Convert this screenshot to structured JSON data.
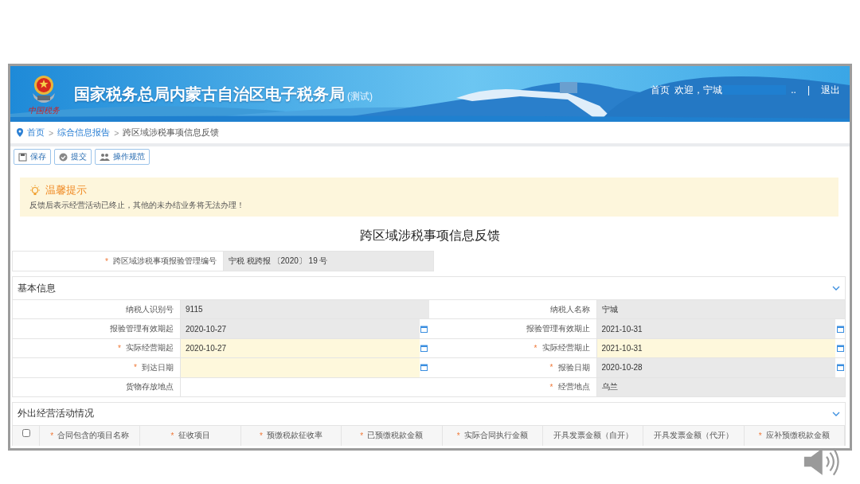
{
  "header": {
    "logo_caption": "中国税务",
    "title": "国家税务总局内蒙古自治区电子税务局",
    "title_note": "(测试)",
    "home": "首页",
    "welcome": "欢迎，宁城",
    "ellipsis": "..",
    "separator": "|",
    "logout": "退出"
  },
  "breadcrumb": [
    {
      "label": "首页",
      "link": true
    },
    {
      "label": "综合信息报告",
      "link": true
    },
    {
      "label": "跨区域涉税事项信息反馈",
      "link": false
    }
  ],
  "breadcrumb_separator": ">",
  "required_mark": "*",
  "toolbar": [
    {
      "label": "保存",
      "kind": "save"
    },
    {
      "label": "提交",
      "kind": "submit"
    },
    {
      "label": "操作规范",
      "kind": "guide"
    }
  ],
  "notice": {
    "title": "温馨提示",
    "text": "反馈后表示经营活动已终止，其他的未办结业务将无法办理！"
  },
  "form_title": "跨区域涉税事项信息反馈",
  "management_number": {
    "label": "跨区域涉税事项报验管理编号",
    "required": true,
    "value": "宁税 税跨报 〔2020〕 19 号"
  },
  "basic_section": {
    "title": "基本信息",
    "expanded": true,
    "rows": [
      [
        {
          "label": "纳税人识别号",
          "required": false,
          "value": "9115",
          "kind": "readonly",
          "calendar": false
        },
        {
          "label": "纳税人名称",
          "required": false,
          "value": "宁城",
          "kind": "readonly",
          "calendar": false
        }
      ],
      [
        {
          "label": "报验管理有效期起",
          "required": false,
          "value": "2020-10-27",
          "kind": "readonly",
          "calendar": true
        },
        {
          "label": "报验管理有效期止",
          "required": false,
          "value": "2021-10-31",
          "kind": "readonly",
          "calendar": true
        }
      ],
      [
        {
          "label": "实际经营期起",
          "required": true,
          "value": "2020-10-27",
          "kind": "editable",
          "calendar": true
        },
        {
          "label": "实际经营期止",
          "required": true,
          "value": "2021-10-31",
          "kind": "editable",
          "calendar": true
        }
      ],
      [
        {
          "label": "到达日期",
          "required": true,
          "kind": "editable",
          "calendar": true
        },
        {
          "label": "报验日期",
          "required": true,
          "value": "2020-10-28",
          "kind": "readonly",
          "calendar": true
        }
      ],
      [
        {
          "label": "货物存放地点",
          "required": false,
          "kind": "plain",
          "calendar": false
        },
        {
          "label": "经营地点",
          "required": true,
          "value": "乌兰",
          "kind": "readonly",
          "calendar": false
        }
      ]
    ]
  },
  "activity_section": {
    "title": "外出经营活动情况",
    "expanded": true,
    "select_all": {
      "checked": false
    },
    "columns": [
      {
        "label": "合同包含的项目名称",
        "required": true
      },
      {
        "label": "征收项目",
        "required": true
      },
      {
        "label": "预缴税款征收率",
        "required": true
      },
      {
        "label": "已预缴税款金额",
        "required": true
      },
      {
        "label": "实际合同执行金额",
        "required": true
      },
      {
        "label": "开具发票金额（自开）",
        "required": false
      },
      {
        "label": "开具发票金额（代开）",
        "required": false
      },
      {
        "label": "应补预缴税款金额",
        "required": true
      }
    ]
  }
}
